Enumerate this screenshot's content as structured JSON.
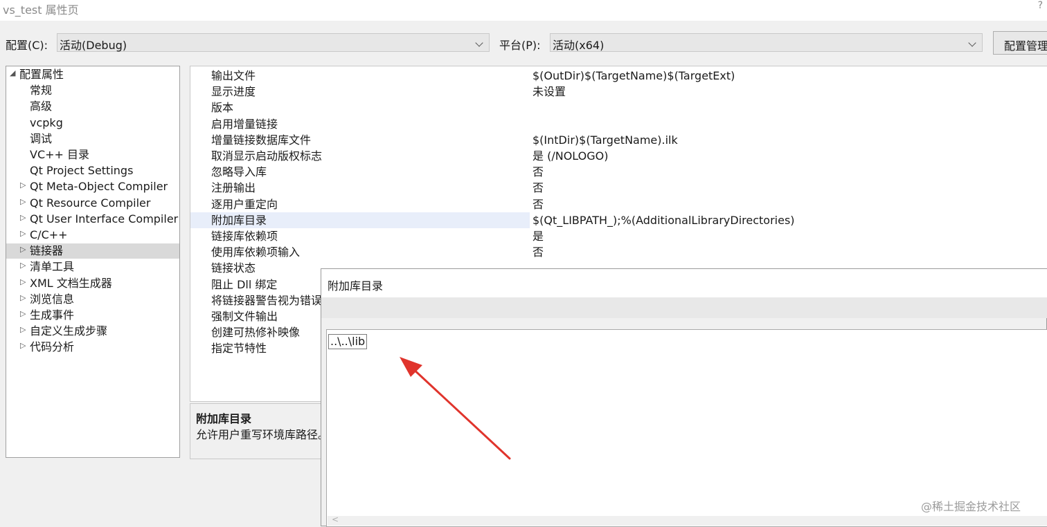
{
  "window": {
    "title": "vs_test 属性页",
    "help": "?"
  },
  "config_bar": {
    "config_label": "配置(C):",
    "config_value": "活动(Debug)",
    "platform_label": "平台(P):",
    "platform_value": "活动(x64)",
    "manager_button": "配置管理器"
  },
  "tree": {
    "items": [
      {
        "label": "配置属性",
        "expander": "◢",
        "level": 0,
        "selected": false
      },
      {
        "label": "常规",
        "expander": "",
        "level": 1,
        "selected": false
      },
      {
        "label": "高级",
        "expander": "",
        "level": 1,
        "selected": false
      },
      {
        "label": "vcpkg",
        "expander": "",
        "level": 1,
        "selected": false
      },
      {
        "label": "调试",
        "expander": "",
        "level": 1,
        "selected": false
      },
      {
        "label": "VC++ 目录",
        "expander": "",
        "level": 1,
        "selected": false
      },
      {
        "label": "Qt Project Settings",
        "expander": "",
        "level": 1,
        "selected": false
      },
      {
        "label": "Qt Meta-Object Compiler",
        "expander": "▷",
        "level": 1,
        "selected": false
      },
      {
        "label": "Qt Resource Compiler",
        "expander": "▷",
        "level": 1,
        "selected": false
      },
      {
        "label": "Qt User Interface Compiler",
        "expander": "▷",
        "level": 1,
        "selected": false
      },
      {
        "label": "C/C++",
        "expander": "▷",
        "level": 1,
        "selected": false
      },
      {
        "label": "链接器",
        "expander": "▷",
        "level": 1,
        "selected": true
      },
      {
        "label": "清单工具",
        "expander": "▷",
        "level": 1,
        "selected": false
      },
      {
        "label": "XML 文档生成器",
        "expander": "▷",
        "level": 1,
        "selected": false
      },
      {
        "label": "浏览信息",
        "expander": "▷",
        "level": 1,
        "selected": false
      },
      {
        "label": "生成事件",
        "expander": "▷",
        "level": 1,
        "selected": false
      },
      {
        "label": "自定义生成步骤",
        "expander": "▷",
        "level": 1,
        "selected": false
      },
      {
        "label": "代码分析",
        "expander": "▷",
        "level": 1,
        "selected": false
      }
    ]
  },
  "properties": {
    "rows": [
      {
        "name": "输出文件",
        "value": "$(OutDir)$(TargetName)$(TargetExt)",
        "highlight": false
      },
      {
        "name": "显示进度",
        "value": "未设置",
        "highlight": false
      },
      {
        "name": "版本",
        "value": "",
        "highlight": false
      },
      {
        "name": "启用增量链接",
        "value": "",
        "highlight": false
      },
      {
        "name": "增量链接数据库文件",
        "value": "$(IntDir)$(TargetName).ilk",
        "highlight": false
      },
      {
        "name": "取消显示启动版权标志",
        "value": "是 (/NOLOGO)",
        "highlight": false
      },
      {
        "name": "忽略导入库",
        "value": "否",
        "highlight": false
      },
      {
        "name": "注册输出",
        "value": "否",
        "highlight": false
      },
      {
        "name": "逐用户重定向",
        "value": "否",
        "highlight": false
      },
      {
        "name": "附加库目录",
        "value": "$(Qt_LIBPATH_);%(AdditionalLibraryDirectories)",
        "highlight": true
      },
      {
        "name": "链接库依赖项",
        "value": "是",
        "highlight": false
      },
      {
        "name": "使用库依赖项输入",
        "value": "否",
        "highlight": false
      },
      {
        "name": "链接状态",
        "value": "",
        "highlight": false
      },
      {
        "name": "阻止 Dll 绑定",
        "value": "",
        "highlight": false
      },
      {
        "name": "将链接器警告视为错误",
        "value": "",
        "highlight": false
      },
      {
        "name": "强制文件输出",
        "value": "",
        "highlight": false
      },
      {
        "name": "创建可热修补映像",
        "value": "",
        "highlight": false
      },
      {
        "name": "指定节特性",
        "value": "",
        "highlight": false
      }
    ]
  },
  "description": {
    "title": "附加库目录",
    "text": "允许用户重写环境库路径。"
  },
  "dialog": {
    "title": "附加库目录",
    "entries": [
      "..\\..\\lib"
    ],
    "scroll_left": "<"
  },
  "annotation": {
    "arrow_color": "#e0342c"
  },
  "watermark": "@稀土掘金技术社区"
}
